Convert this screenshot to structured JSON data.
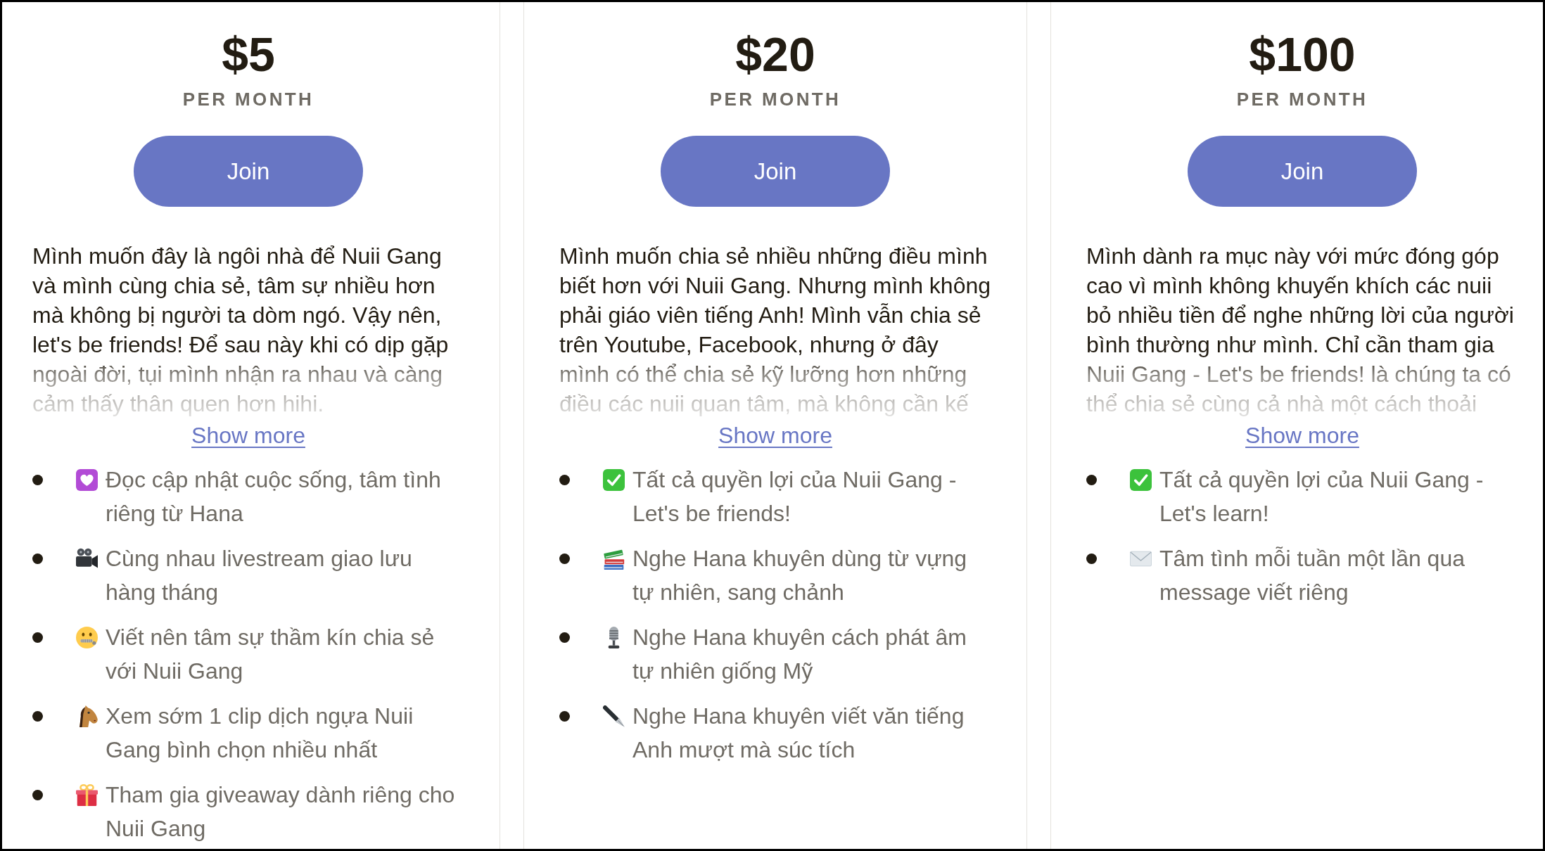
{
  "tiers": [
    {
      "price": "$5",
      "period": "PER MONTH",
      "join_button": "Join",
      "description": {
        "expanded": false,
        "lines": [
          "Mình muốn đây là ngôi nhà để Nuii Gang",
          "và mình cùng chia sẻ, tâm sự nhiều hơn",
          "mà không bị người ta dòm ngó. Vậy nên,",
          "let's be friends! Để sau này khi có dịp gặp",
          "ngoài đời, tụi mình nhận ra nhau và càng",
          "cảm thấy thân quen hơn hihi."
        ]
      },
      "show_more": "Show more",
      "benefits": [
        "Đọc cập nhật cuộc sống, tâm tình riêng từ Hana",
        "Cùng nhau livestream giao lưu hàng tháng",
        "Viết nên tâm sự thầm kín chia sẻ với Nuii Gang",
        "Xem sớm 1 clip dịch ngựa Nuii Gang bình chọn nhiều nhất",
        "Tham gia giveaway dành riêng cho Nuii Gang"
      ]
    },
    {
      "price": "$20",
      "period": "PER MONTH",
      "join_button": "Join",
      "description": {
        "expanded": false,
        "lines": [
          "Mình muốn chia sẻ nhiều những điều mình",
          "biết hơn với Nuii Gang. Nhưng mình không",
          "phải giáo viên tiếng Anh! Mình vẫn chia sẻ",
          "trên Youtube, Facebook, nhưng ở đây",
          "mình có thể chia sẻ kỹ lưỡng hơn những",
          "điều các nuii quan tâm, mà không cần kế"
        ]
      },
      "show_more": "Show more",
      "benefits": [
        "Tất cả quyền lợi của Nuii Gang - Let's be friends!",
        "Nghe Hana khuyên dùng từ vựng tự nhiên, sang chảnh",
        "Nghe Hana khuyên cách phát âm tự nhiên giống Mỹ",
        "Nghe Hana khuyên viết văn tiếng Anh mượt mà súc tích"
      ]
    },
    {
      "price": "$100",
      "period": "PER MONTH",
      "join_button": "Join",
      "description": {
        "expanded": false,
        "lines": [
          "Mình dành ra mục này với mức đóng góp",
          "cao vì mình không khuyến khích các nuii",
          "bỏ nhiều tiền để nghe những lời của người",
          "bình thường như mình. Chỉ cần tham gia",
          "Nuii Gang - Let's be friends! là chúng ta có",
          "thể chia sẻ cùng cả nhà một cách thoải"
        ]
      },
      "show_more": "Show more",
      "benefits": [
        "Tất cả quyền lợi của Nuii Gang - Let's learn!",
        "Tâm tình mỗi tuần một lần qua message viết riêng"
      ]
    }
  ]
}
